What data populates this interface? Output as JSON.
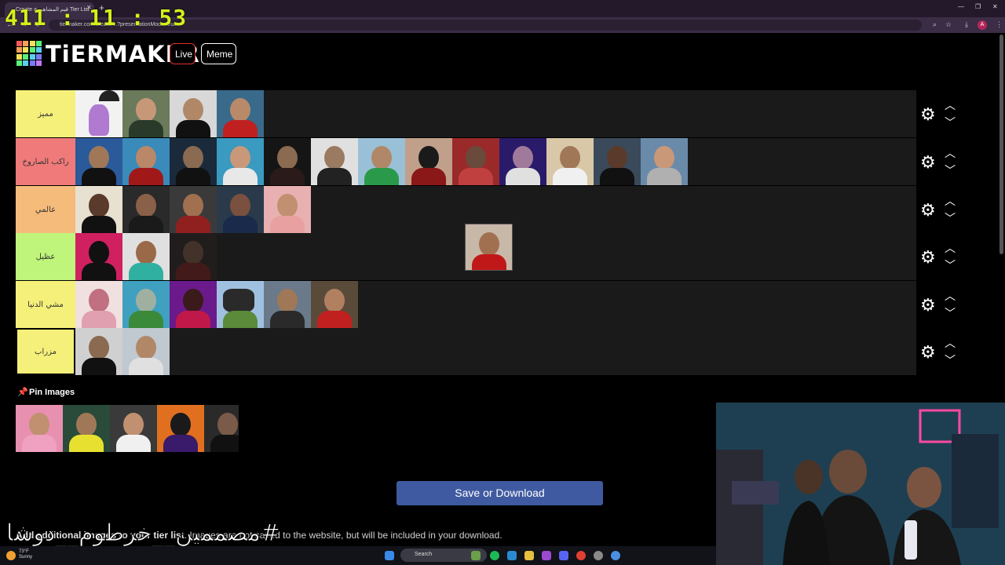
{
  "clock": "411 : 11 : 53",
  "browser": {
    "tab_title": "Create a قيم المشاهير Tier List",
    "url": "tiermaker.com/create/...?presentationMode=true",
    "profile_initial": "A"
  },
  "header": {
    "logo_text": "TiERMAKER",
    "live_label": "Live",
    "meme_label": "Meme"
  },
  "tiers": [
    {
      "label": "مميز",
      "color": "#f5f07a",
      "count": 4
    },
    {
      "label": "راكب الصاروخ",
      "color": "#f07a7a",
      "count": 13
    },
    {
      "label": "عالمي",
      "color": "#f5bb7a",
      "count": 5
    },
    {
      "label": "عظيل",
      "color": "#bff57a",
      "count": 3
    },
    {
      "label": "مشي الدنيا",
      "color": "#f5f07a",
      "count": 6
    },
    {
      "label": "مزراب",
      "color": "#f5f07a",
      "count": 2
    }
  ],
  "pin_images": {
    "title": "Pin Images",
    "count": 5
  },
  "save_button": "Save or Download",
  "additional_note_bold": "Add additional images to your tier list",
  "additional_note_rest": ". Images are not saved to the website, but will be included in your download.",
  "overlay_hashtag": "#مصممين__خرطوم__دوشا",
  "taskbar": {
    "search_placeholder": "Search",
    "weather_temp": "73°F",
    "weather_desc": "Sunny"
  }
}
